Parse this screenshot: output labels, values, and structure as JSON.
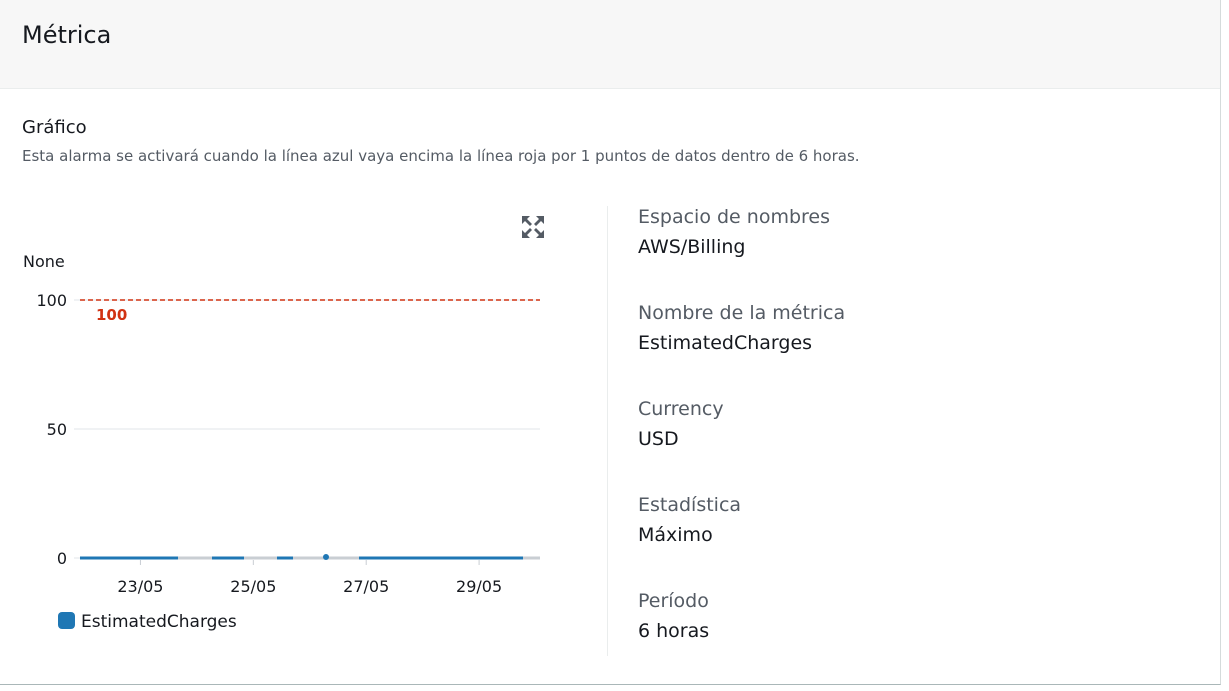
{
  "header": {
    "title": "Métrica"
  },
  "graph": {
    "title": "Gráfico",
    "description": "Esta alarma se activará cuando la línea azul vaya encima la línea roja por 1 puntos de datos dentro de 6 horas."
  },
  "chart_data": {
    "type": "line",
    "ylabel": "None",
    "ylim": [
      0,
      100
    ],
    "yticks": [
      "100",
      "50",
      "0"
    ],
    "xticks": [
      "23/05",
      "25/05",
      "27/05",
      "29/05"
    ],
    "threshold": {
      "value": 100,
      "label": "100",
      "color": "#d13212"
    },
    "series": [
      {
        "name": "EstimatedCharges",
        "color": "#1f77b4",
        "segments": [
          {
            "x": [
              "22/05",
              "24/04"
            ],
            "y": [
              0,
              0
            ]
          },
          {
            "x": [
              "24/12",
              "25/06"
            ],
            "y": [
              0,
              0
            ]
          },
          {
            "x": [
              "25/18",
              "26/00"
            ],
            "y": [
              0,
              0
            ]
          },
          {
            "x": [
              "26/12",
              "26/12"
            ],
            "y": [
              0,
              0
            ]
          },
          {
            "x": [
              "27/00",
              "29/24"
            ],
            "y": [
              0,
              0
            ]
          }
        ]
      }
    ],
    "legend": "bottom-left"
  },
  "details": [
    {
      "key": "Espacio de nombres",
      "value": "AWS/Billing"
    },
    {
      "key": "Nombre de la métrica",
      "value": "EstimatedCharges"
    },
    {
      "key": "Currency",
      "value": "USD"
    },
    {
      "key": "Estadística",
      "value": "Máximo"
    },
    {
      "key": "Período",
      "value": "6 horas"
    }
  ],
  "icons": {
    "expand": "expand-arrows-icon"
  }
}
